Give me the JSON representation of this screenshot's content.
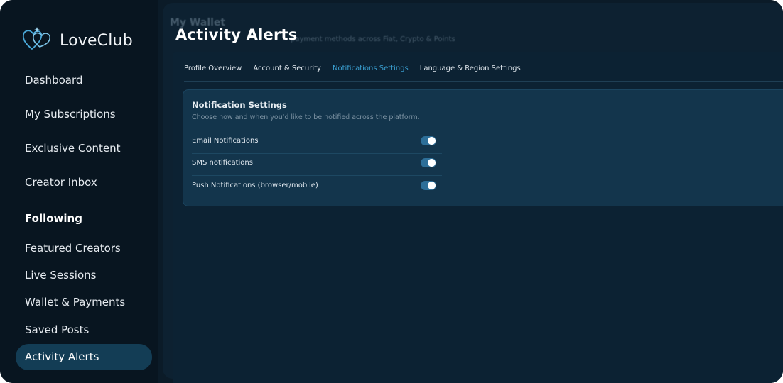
{
  "brand": {
    "name": "LoveClub",
    "logo_icon": "double-heart-logo-icon",
    "accent": "#4aa8d8"
  },
  "sidebar": {
    "items": [
      {
        "label": "Dashboard"
      },
      {
        "label": "My Subscriptions"
      },
      {
        "label": "Exclusive Content"
      },
      {
        "label": "Creator Inbox"
      }
    ],
    "section_heading": "Following",
    "following_items": [
      {
        "label": "Featured Creators"
      },
      {
        "label": "Live Sessions"
      },
      {
        "label": "Wallet & Payments"
      },
      {
        "label": "Saved Posts"
      },
      {
        "label": "Activity Alerts",
        "active": true
      }
    ]
  },
  "main": {
    "title": "Activity Alerts",
    "background_title": "My Wallet",
    "background_subtitle": "payment methods across Fiat, Crypto & Points",
    "tabs": [
      {
        "label": "Profile Overview"
      },
      {
        "label": "Account & Security"
      },
      {
        "label": "Notifications Settings",
        "active": true
      },
      {
        "label": "Language & Region Settings"
      }
    ],
    "notification_card": {
      "title": "Notification Settings",
      "description": "Choose how and when you'd like to be notified across the platform.",
      "rows": [
        {
          "label": "Email Notifications",
          "enabled": true
        },
        {
          "label": "SMS notifications",
          "enabled": true
        },
        {
          "label": "Push Notifications (browser/mobile)",
          "enabled": true
        }
      ]
    }
  }
}
